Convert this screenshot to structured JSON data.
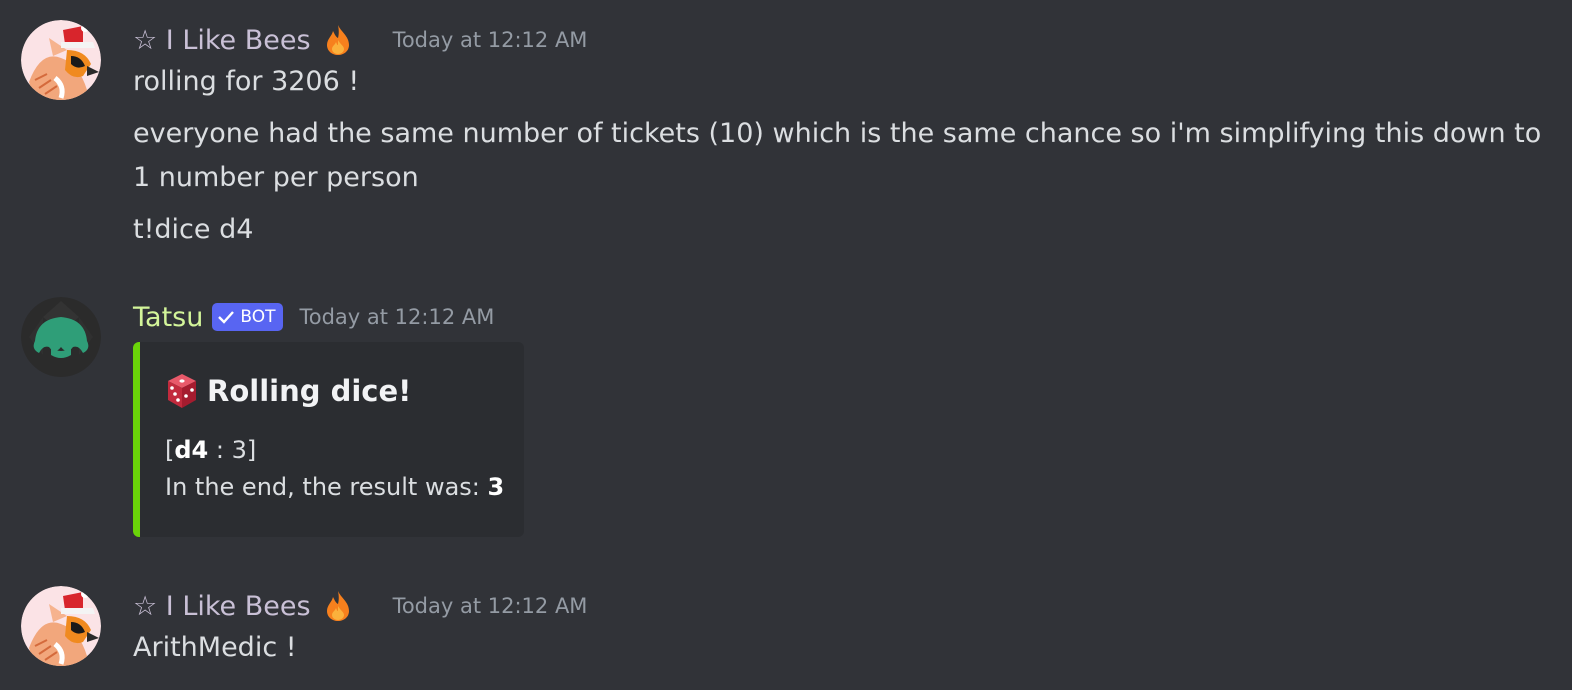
{
  "messages": [
    {
      "author": "☆ I Like Bees",
      "badge_icon": "flame-icon",
      "timestamp": "Today at 12:12 AM",
      "lines": [
        "rolling for 3206 !",
        "everyone had the same number of tickets (10) which is the same chance so i'm simplifying this down to 1 number per person",
        "t!dice d4"
      ]
    },
    {
      "author": "Tatsu",
      "bot_tag": "BOT",
      "timestamp": "Today at 12:12 AM",
      "embed": {
        "title": "Rolling dice!",
        "title_icon": "game-die-icon",
        "roll_open": "[",
        "roll_die": "d4",
        "roll_rest": " : 3]",
        "result_prefix": "In the end, the result was: ",
        "result_value": "3",
        "accent_color": "#6ad409"
      }
    },
    {
      "author": "☆ I Like Bees",
      "badge_icon": "flame-icon",
      "timestamp": "Today at 12:12 AM",
      "lines": [
        "ArithMedic !"
      ]
    }
  ],
  "colors": {
    "background": "#313338",
    "user_name": "#c9c0d6",
    "bot_name": "#d3f59a",
    "bot_tag": "#5865f2",
    "timestamp": "#949ba4"
  }
}
